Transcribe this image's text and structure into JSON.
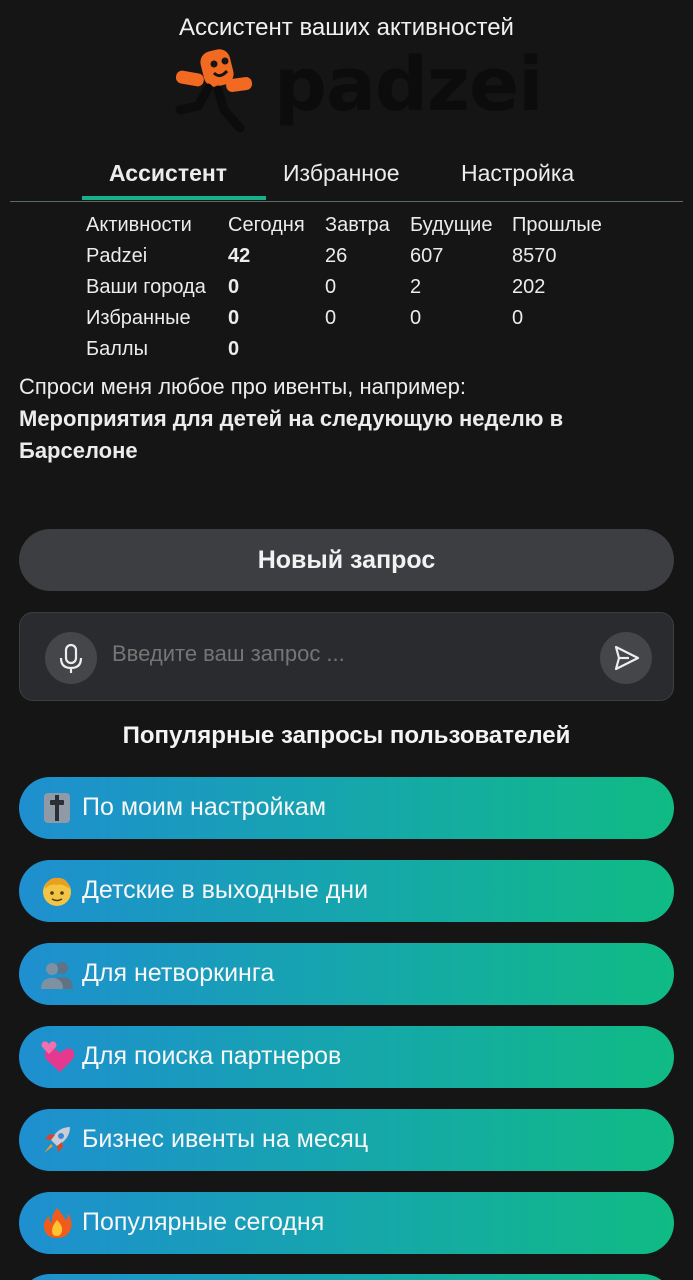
{
  "header": {
    "subtitle": "Ассистент ваших активностей",
    "logo_text": "padzei"
  },
  "tabs": [
    {
      "label": "Ассистент",
      "active": true
    },
    {
      "label": "Избранное",
      "active": false
    },
    {
      "label": "Настройка",
      "active": false
    }
  ],
  "stats": {
    "columns": [
      "Активности",
      "Сегодня",
      "Завтра",
      "Будущие",
      "Прошлые"
    ],
    "rows": [
      {
        "label": "Padzei",
        "today": "42",
        "tomorrow": "26",
        "future": "607",
        "past": "8570"
      },
      {
        "label": "Ваши города",
        "today": "0",
        "tomorrow": "0",
        "future": "2",
        "past": "202"
      },
      {
        "label": "Избранные",
        "today": "0",
        "tomorrow": "0",
        "future": "0",
        "past": "0"
      },
      {
        "label": "Баллы",
        "today": "0"
      }
    ]
  },
  "hint": {
    "intro": "Спроси меня любое про ивенты, например:",
    "example": "Мероприятия для детей на следующую неделю в Барселоне"
  },
  "new_query_label": "Новый запрос",
  "input": {
    "placeholder": "Введите ваш запрос ...",
    "value": ""
  },
  "popular": {
    "title": "Популярные запросы пользователей",
    "items": [
      {
        "icon": "slider-icon",
        "label": "По моим настройкам"
      },
      {
        "icon": "child-icon",
        "label": "Детские в выходные дни"
      },
      {
        "icon": "people-icon",
        "label": "Для нетворкинга"
      },
      {
        "icon": "hearts-icon",
        "label": "Для поиска партнеров"
      },
      {
        "icon": "rocket-icon",
        "label": "Бизнес ивенты на месяц"
      },
      {
        "icon": "fire-icon",
        "label": "Популярные сегодня"
      }
    ]
  },
  "colors": {
    "accent": "#16b08a",
    "background": "#151516",
    "logo_orange": "#f26a21"
  }
}
